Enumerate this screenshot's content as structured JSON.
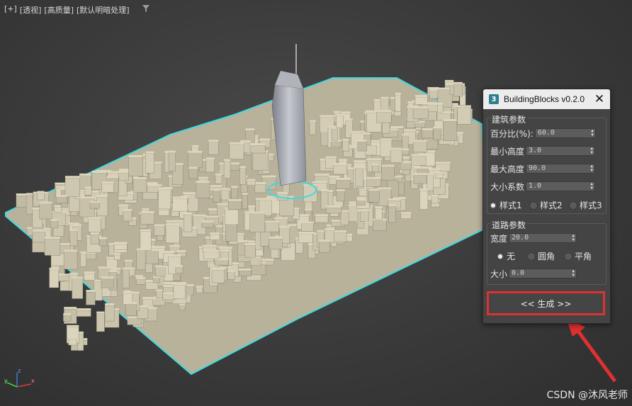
{
  "viewport": {
    "labels": [
      "[+]",
      "[透视]",
      "[高质量]",
      "[默认明暗处理]"
    ],
    "filter_icon": "funnel-icon"
  },
  "panel": {
    "title": "BuildingBlocks v0.2.0",
    "app_icon_glyph": "3",
    "close_glyph": "✕",
    "building_group": {
      "title": "建筑参数",
      "fields": [
        {
          "label": "百分比(%):",
          "value": "60.0"
        },
        {
          "label": "最小高度",
          "value": "3.0"
        },
        {
          "label": "最大高度",
          "value": "90.0"
        },
        {
          "label": "大小系数",
          "value": "1.0"
        }
      ],
      "styles": [
        "样式1",
        "样式2",
        "样式3"
      ],
      "selected_style": "样式1"
    },
    "road_group": {
      "title": "道路参数",
      "width_label": "宽度",
      "width_value": "20.0",
      "corner_options": [
        "无",
        "圆角",
        "平角"
      ],
      "selected_corner": "无",
      "size_label": "大小",
      "size_value": "0.0"
    },
    "generate_label": "<< 生成 >>"
  },
  "axis_labels": {
    "z": "z",
    "x": "x",
    "y": "y"
  },
  "watermark": "CSDN @沐风老师",
  "colors": {
    "highlight_outline": "#3fd9e0",
    "red_annotation": "#e03030",
    "building": "#cfc8ae"
  }
}
